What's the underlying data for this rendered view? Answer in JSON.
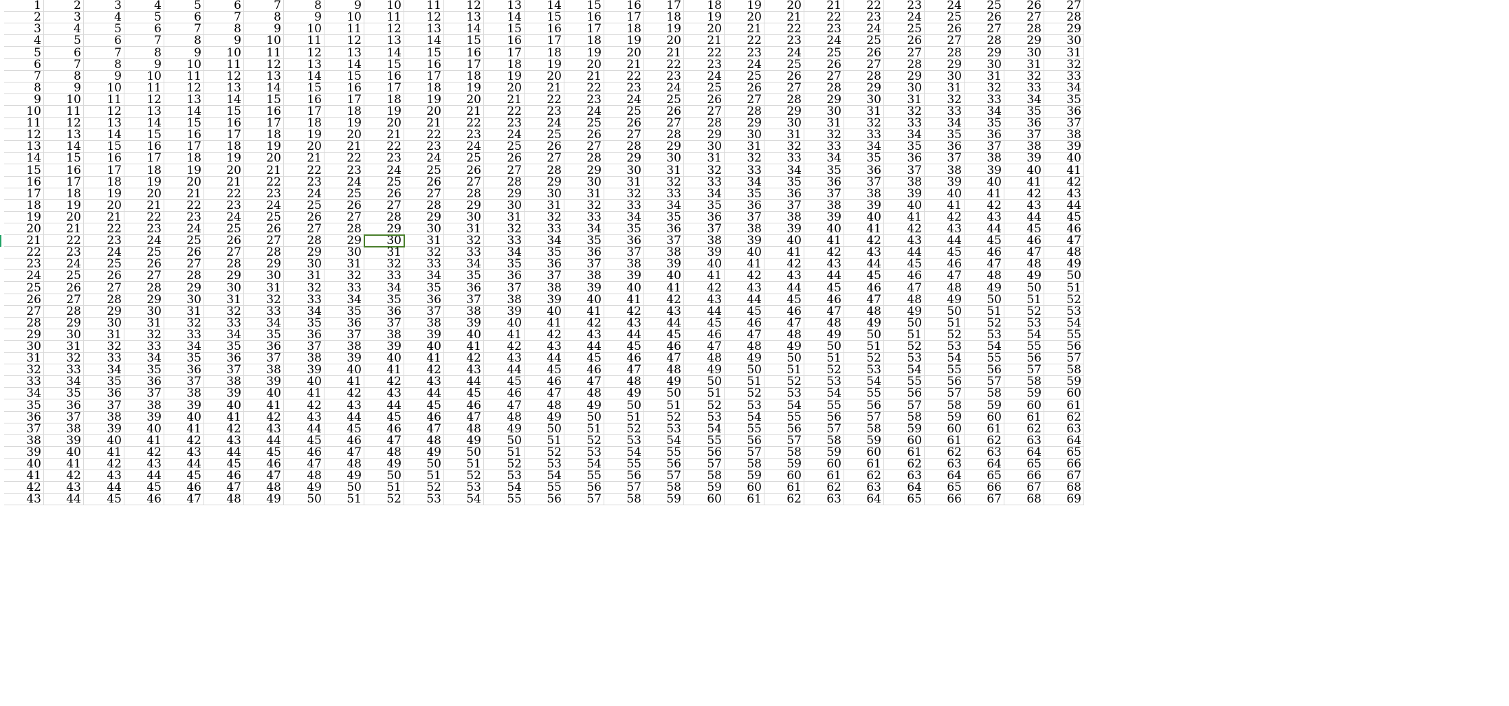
{
  "sheet": {
    "first_row_start": 1,
    "visible_row_count": 43,
    "visible_col_count": 27,
    "rows": [
      [
        "1",
        "2",
        "3",
        "4",
        "5",
        "6",
        "7",
        "8",
        "9",
        "10",
        "11",
        "12",
        "13",
        "14",
        "15",
        "16",
        "17",
        "18",
        "19",
        "20",
        "21",
        "22",
        "23",
        "24",
        "25",
        "26",
        "27"
      ],
      [
        "2",
        "3",
        "4",
        "5",
        "6",
        "7",
        "8",
        "9",
        "10",
        "11",
        "12",
        "13",
        "14",
        "15",
        "16",
        "17",
        "18",
        "19",
        "20",
        "21",
        "22",
        "23",
        "24",
        "25",
        "26",
        "27",
        "28"
      ],
      [
        "3",
        "4",
        "5",
        "6",
        "7",
        "8",
        "9",
        "10",
        "11",
        "12",
        "13",
        "14",
        "15",
        "16",
        "17",
        "18",
        "19",
        "20",
        "21",
        "22",
        "23",
        "24",
        "25",
        "26",
        "27",
        "28",
        "29"
      ],
      [
        "4",
        "5",
        "6",
        "7",
        "8",
        "9",
        "10",
        "11",
        "12",
        "13",
        "14",
        "15",
        "16",
        "17",
        "18",
        "19",
        "20",
        "21",
        "22",
        "23",
        "24",
        "25",
        "26",
        "27",
        "28",
        "29",
        "30"
      ],
      [
        "5",
        "6",
        "7",
        "8",
        "9",
        "10",
        "11",
        "12",
        "13",
        "14",
        "15",
        "16",
        "17",
        "18",
        "19",
        "20",
        "21",
        "22",
        "23",
        "24",
        "25",
        "26",
        "27",
        "28",
        "29",
        "30",
        "31"
      ],
      [
        "6",
        "7",
        "8",
        "9",
        "10",
        "11",
        "12",
        "13",
        "14",
        "15",
        "16",
        "17",
        "18",
        "19",
        "20",
        "21",
        "22",
        "23",
        "24",
        "25",
        "26",
        "27",
        "28",
        "29",
        "30",
        "31",
        "32"
      ],
      [
        "7",
        "8",
        "9",
        "10",
        "11",
        "12",
        "13",
        "14",
        "15",
        "16",
        "17",
        "18",
        "19",
        "20",
        "21",
        "22",
        "23",
        "24",
        "25",
        "26",
        "27",
        "28",
        "29",
        "30",
        "31",
        "32",
        "33"
      ],
      [
        "8",
        "9",
        "10",
        "11",
        "12",
        "13",
        "14",
        "15",
        "16",
        "17",
        "18",
        "19",
        "20",
        "21",
        "22",
        "23",
        "24",
        "25",
        "26",
        "27",
        "28",
        "29",
        "30",
        "31",
        "32",
        "33",
        "34"
      ],
      [
        "9",
        "10",
        "11",
        "12",
        "13",
        "14",
        "15",
        "16",
        "17",
        "18",
        "19",
        "20",
        "21",
        "22",
        "23",
        "24",
        "25",
        "26",
        "27",
        "28",
        "29",
        "30",
        "31",
        "32",
        "33",
        "34",
        "35"
      ],
      [
        "10",
        "11",
        "12",
        "13",
        "14",
        "15",
        "16",
        "17",
        "18",
        "19",
        "20",
        "21",
        "22",
        "23",
        "24",
        "25",
        "26",
        "27",
        "28",
        "29",
        "30",
        "31",
        "32",
        "33",
        "34",
        "35",
        "36"
      ],
      [
        "11",
        "12",
        "13",
        "14",
        "15",
        "16",
        "17",
        "18",
        "19",
        "20",
        "21",
        "22",
        "23",
        "24",
        "25",
        "26",
        "27",
        "28",
        "29",
        "30",
        "31",
        "32",
        "33",
        "34",
        "35",
        "36",
        "37"
      ],
      [
        "12",
        "13",
        "14",
        "15",
        "16",
        "17",
        "18",
        "19",
        "20",
        "21",
        "22",
        "23",
        "24",
        "25",
        "26",
        "27",
        "28",
        "29",
        "30",
        "31",
        "32",
        "33",
        "34",
        "35",
        "36",
        "37",
        "38"
      ],
      [
        "13",
        "14",
        "15",
        "16",
        "17",
        "18",
        "19",
        "20",
        "21",
        "22",
        "23",
        "24",
        "25",
        "26",
        "27",
        "28",
        "29",
        "30",
        "31",
        "32",
        "33",
        "34",
        "35",
        "36",
        "37",
        "38",
        "39"
      ],
      [
        "14",
        "15",
        "16",
        "17",
        "18",
        "19",
        "20",
        "21",
        "22",
        "23",
        "24",
        "25",
        "26",
        "27",
        "28",
        "29",
        "30",
        "31",
        "32",
        "33",
        "34",
        "35",
        "36",
        "37",
        "38",
        "39",
        "40"
      ],
      [
        "15",
        "16",
        "17",
        "18",
        "19",
        "20",
        "21",
        "22",
        "23",
        "24",
        "25",
        "26",
        "27",
        "28",
        "29",
        "30",
        "31",
        "32",
        "33",
        "34",
        "35",
        "36",
        "37",
        "38",
        "39",
        "40",
        "41"
      ],
      [
        "16",
        "17",
        "18",
        "19",
        "20",
        "21",
        "22",
        "23",
        "24",
        "25",
        "26",
        "27",
        "28",
        "29",
        "30",
        "31",
        "32",
        "33",
        "34",
        "35",
        "36",
        "37",
        "38",
        "39",
        "40",
        "41",
        "42"
      ],
      [
        "17",
        "18",
        "19",
        "20",
        "21",
        "22",
        "23",
        "24",
        "25",
        "26",
        "27",
        "28",
        "29",
        "30",
        "31",
        "32",
        "33",
        "34",
        "35",
        "36",
        "37",
        "38",
        "39",
        "40",
        "41",
        "42",
        "43"
      ],
      [
        "18",
        "19",
        "20",
        "21",
        "22",
        "23",
        "24",
        "25",
        "26",
        "27",
        "28",
        "29",
        "30",
        "31",
        "32",
        "33",
        "34",
        "35",
        "36",
        "37",
        "38",
        "39",
        "40",
        "41",
        "42",
        "43",
        "44"
      ],
      [
        "19",
        "20",
        "21",
        "22",
        "23",
        "24",
        "25",
        "26",
        "27",
        "28",
        "29",
        "30",
        "31",
        "32",
        "33",
        "34",
        "35",
        "36",
        "37",
        "38",
        "39",
        "40",
        "41",
        "42",
        "43",
        "44",
        "45"
      ],
      [
        "20",
        "21",
        "22",
        "23",
        "24",
        "25",
        "26",
        "27",
        "28",
        "29",
        "30",
        "31",
        "32",
        "33",
        "34",
        "35",
        "36",
        "37",
        "38",
        "39",
        "40",
        "41",
        "42",
        "43",
        "44",
        "45",
        "46"
      ],
      [
        "21",
        "22",
        "23",
        "24",
        "25",
        "26",
        "27",
        "28",
        "29",
        "30",
        "31",
        "32",
        "33",
        "34",
        "35",
        "36",
        "37",
        "38",
        "39",
        "40",
        "41",
        "42",
        "43",
        "44",
        "45",
        "46",
        "47"
      ],
      [
        "22",
        "23",
        "24",
        "25",
        "26",
        "27",
        "28",
        "29",
        "30",
        "31",
        "32",
        "33",
        "34",
        "35",
        "36",
        "37",
        "38",
        "39",
        "40",
        "41",
        "42",
        "43",
        "44",
        "45",
        "46",
        "47",
        "48"
      ],
      [
        "23",
        "24",
        "25",
        "26",
        "27",
        "28",
        "29",
        "30",
        "31",
        "32",
        "33",
        "34",
        "35",
        "36",
        "37",
        "38",
        "39",
        "40",
        "41",
        "42",
        "43",
        "44",
        "45",
        "46",
        "47",
        "48",
        "49"
      ],
      [
        "24",
        "25",
        "26",
        "27",
        "28",
        "29",
        "30",
        "31",
        "32",
        "33",
        "34",
        "35",
        "36",
        "37",
        "38",
        "39",
        "40",
        "41",
        "42",
        "43",
        "44",
        "45",
        "46",
        "47",
        "48",
        "49",
        "50"
      ],
      [
        "25",
        "26",
        "27",
        "28",
        "29",
        "30",
        "31",
        "32",
        "33",
        "34",
        "35",
        "36",
        "37",
        "38",
        "39",
        "40",
        "41",
        "42",
        "43",
        "44",
        "45",
        "46",
        "47",
        "48",
        "49",
        "50",
        "51"
      ],
      [
        "26",
        "27",
        "28",
        "29",
        "30",
        "31",
        "32",
        "33",
        "34",
        "35",
        "36",
        "37",
        "38",
        "39",
        "40",
        "41",
        "42",
        "43",
        "44",
        "45",
        "46",
        "47",
        "48",
        "49",
        "50",
        "51",
        "52"
      ],
      [
        "27",
        "28",
        "29",
        "30",
        "31",
        "32",
        "33",
        "34",
        "35",
        "36",
        "37",
        "38",
        "39",
        "40",
        "41",
        "42",
        "43",
        "44",
        "45",
        "46",
        "47",
        "48",
        "49",
        "50",
        "51",
        "52",
        "53"
      ],
      [
        "28",
        "29",
        "30",
        "31",
        "32",
        "33",
        "34",
        "35",
        "36",
        "37",
        "38",
        "39",
        "40",
        "41",
        "42",
        "43",
        "44",
        "45",
        "46",
        "47",
        "48",
        "49",
        "50",
        "51",
        "52",
        "53",
        "54"
      ],
      [
        "29",
        "30",
        "31",
        "32",
        "33",
        "34",
        "35",
        "36",
        "37",
        "38",
        "39",
        "40",
        "41",
        "42",
        "43",
        "44",
        "45",
        "46",
        "47",
        "48",
        "49",
        "50",
        "51",
        "52",
        "53",
        "54",
        "55"
      ],
      [
        "30",
        "31",
        "32",
        "33",
        "34",
        "35",
        "36",
        "37",
        "38",
        "39",
        "40",
        "41",
        "42",
        "43",
        "44",
        "45",
        "46",
        "47",
        "48",
        "49",
        "50",
        "51",
        "52",
        "53",
        "54",
        "55",
        "56"
      ],
      [
        "31",
        "32",
        "33",
        "34",
        "35",
        "36",
        "37",
        "38",
        "39",
        "40",
        "41",
        "42",
        "43",
        "44",
        "45",
        "46",
        "47",
        "48",
        "49",
        "50",
        "51",
        "52",
        "53",
        "54",
        "55",
        "56",
        "57"
      ],
      [
        "32",
        "33",
        "34",
        "35",
        "36",
        "37",
        "38",
        "39",
        "40",
        "41",
        "42",
        "43",
        "44",
        "45",
        "46",
        "47",
        "48",
        "49",
        "50",
        "51",
        "52",
        "53",
        "54",
        "55",
        "56",
        "57",
        "58"
      ],
      [
        "33",
        "34",
        "35",
        "36",
        "37",
        "38",
        "39",
        "40",
        "41",
        "42",
        "43",
        "44",
        "45",
        "46",
        "47",
        "48",
        "49",
        "50",
        "51",
        "52",
        "53",
        "54",
        "55",
        "56",
        "57",
        "58",
        "59"
      ],
      [
        "34",
        "35",
        "36",
        "37",
        "38",
        "39",
        "40",
        "41",
        "42",
        "43",
        "44",
        "45",
        "46",
        "47",
        "48",
        "49",
        "50",
        "51",
        "52",
        "53",
        "54",
        "55",
        "56",
        "57",
        "58",
        "59",
        "60"
      ],
      [
        "35",
        "36",
        "37",
        "38",
        "39",
        "40",
        "41",
        "42",
        "43",
        "44",
        "45",
        "46",
        "47",
        "48",
        "49",
        "50",
        "51",
        "52",
        "53",
        "54",
        "55",
        "56",
        "57",
        "58",
        "59",
        "60",
        "61"
      ],
      [
        "36",
        "37",
        "38",
        "39",
        "40",
        "41",
        "42",
        "43",
        "44",
        "45",
        "46",
        "47",
        "48",
        "49",
        "50",
        "51",
        "52",
        "53",
        "54",
        "55",
        "56",
        "57",
        "58",
        "59",
        "60",
        "61",
        "62"
      ],
      [
        "37",
        "38",
        "39",
        "40",
        "41",
        "42",
        "43",
        "44",
        "45",
        "46",
        "47",
        "48",
        "49",
        "50",
        "51",
        "52",
        "53",
        "54",
        "55",
        "56",
        "57",
        "58",
        "59",
        "60",
        "61",
        "62",
        "63"
      ],
      [
        "38",
        "39",
        "40",
        "41",
        "42",
        "43",
        "44",
        "45",
        "46",
        "47",
        "48",
        "49",
        "50",
        "51",
        "52",
        "53",
        "54",
        "55",
        "56",
        "57",
        "58",
        "59",
        "60",
        "61",
        "62",
        "63",
        "64"
      ],
      [
        "39",
        "40",
        "41",
        "42",
        "43",
        "44",
        "45",
        "46",
        "47",
        "48",
        "49",
        "50",
        "51",
        "52",
        "53",
        "54",
        "55",
        "56",
        "57",
        "58",
        "59",
        "60",
        "61",
        "62",
        "63",
        "64",
        "65"
      ],
      [
        "40",
        "41",
        "42",
        "43",
        "44",
        "45",
        "46",
        "47",
        "48",
        "49",
        "50",
        "51",
        "52",
        "53",
        "54",
        "55",
        "56",
        "57",
        "58",
        "59",
        "60",
        "61",
        "62",
        "63",
        "64",
        "65",
        "66"
      ],
      [
        "41",
        "42",
        "43",
        "44",
        "45",
        "46",
        "47",
        "48",
        "49",
        "50",
        "51",
        "52",
        "53",
        "54",
        "55",
        "56",
        "57",
        "58",
        "59",
        "60",
        "61",
        "62",
        "63",
        "64",
        "65",
        "66",
        "67"
      ],
      [
        "42",
        "43",
        "44",
        "45",
        "46",
        "47",
        "48",
        "49",
        "50",
        "51",
        "52",
        "53",
        "54",
        "55",
        "56",
        "57",
        "58",
        "59",
        "60",
        "61",
        "62",
        "63",
        "64",
        "65",
        "66",
        "67",
        "68"
      ],
      [
        "43",
        "44",
        "45",
        "46",
        "47",
        "48",
        "49",
        "50",
        "51",
        "52",
        "53",
        "54",
        "55",
        "56",
        "57",
        "58",
        "59",
        "60",
        "61",
        "62",
        "63",
        "64",
        "65",
        "66",
        "67",
        "68",
        "69"
      ]
    ],
    "active_cell": {
      "row_index": 20,
      "col_index": 9,
      "value": "30"
    }
  },
  "colors": {
    "gridline": "#d9d9d9",
    "active_border": "#4a7f2c",
    "text": "#000000",
    "row_marker": "#21a366"
  }
}
